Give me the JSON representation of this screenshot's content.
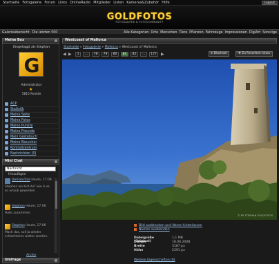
{
  "topbar": {
    "items": [
      "Startseite",
      "Fotogalerie",
      "Forum",
      "Links",
      "OnlineRadio",
      "Mitglieder",
      "Listen",
      "Kameras&Zubehör",
      "Hilfe"
    ],
    "login": "Logout"
  },
  "header": {
    "logo": "GOLDFOTOS",
    "tagline": "FOTOGALERIE & FOTOCOMMUNITY"
  },
  "navbar": {
    "left": [
      "Galerieübersicht",
      "Die letzten 500"
    ],
    "right": [
      "Alle Kategorien",
      "Orte",
      "Menschen",
      "Tiere",
      "Pflanzen",
      "Fahrzeuge",
      "Impressionen",
      "DigiArt",
      "Sonstige"
    ]
  },
  "mebox": {
    "title": "Meine Box",
    "welcome": "Eingeloggt als Stephan",
    "avatar_letter": "G",
    "role": "Administrator",
    "star": "★",
    "points": "5815 Punkte",
    "links": [
      "ACP",
      "Statistik",
      "Meine Seite",
      "Meine Fotos",
      "Meine Punkte",
      "Meine Freunde",
      "Mein Gästebuch",
      "Meine Besucher",
      "Kontrollzentrum",
      "Nachrichten (0)"
    ]
  },
  "chat": {
    "title": "Mini Chat",
    "input_value": "Nachricht",
    "add": "Hinzufügen",
    "messages": [
      {
        "user": "DerFotoTroll",
        "time": "Heute, 17:08",
        "text": "Stephan wo bist du? wie is es so urlaub geworden"
      },
      {
        "user": "Stephan",
        "time": "Heute, 17:06",
        "text": "Hallo zusammen."
      },
      {
        "user": "Stephan",
        "time": "Heute, 17:06",
        "text": "Mach das, soll ja wieder schlechteres wetter werden."
      }
    ],
    "archive": "Archiv"
  },
  "bottombox": {
    "title": "Umfrage"
  },
  "main": {
    "title": "Westcoast of Mallorca",
    "breadcrumb": [
      "Startseite",
      "Fotogalerie",
      "Mallorca",
      "Westcoast of Mallorca"
    ],
    "pages": [
      "1",
      "...",
      "78",
      "79",
      "80",
      "81",
      "82",
      "...",
      "177"
    ],
    "current_page": "81",
    "btn_diashow": "Diashow",
    "btn_fav": "Zu Favoriten hinzu",
    "photo_credit": "© BY STEPHAN GOLDFOTOS"
  },
  "info": {
    "link1": "Bild ausblenden und Name hinterlassen",
    "link2": "Namen ausblenden",
    "props": [
      {
        "k": "Dateigröße (Original)",
        "v": "1,1 MB"
      },
      {
        "k": "Datum",
        "v": "18.06.2008"
      },
      {
        "k": "Breite",
        "v": "3187 px"
      },
      {
        "k": "Höhe",
        "v": "2391 px"
      }
    ],
    "more": "Weitere Eigenschaften (6)"
  },
  "colors": {
    "accent": "#ffd23a",
    "link": "#9ec4ea",
    "sky": "#2e5fb5"
  }
}
